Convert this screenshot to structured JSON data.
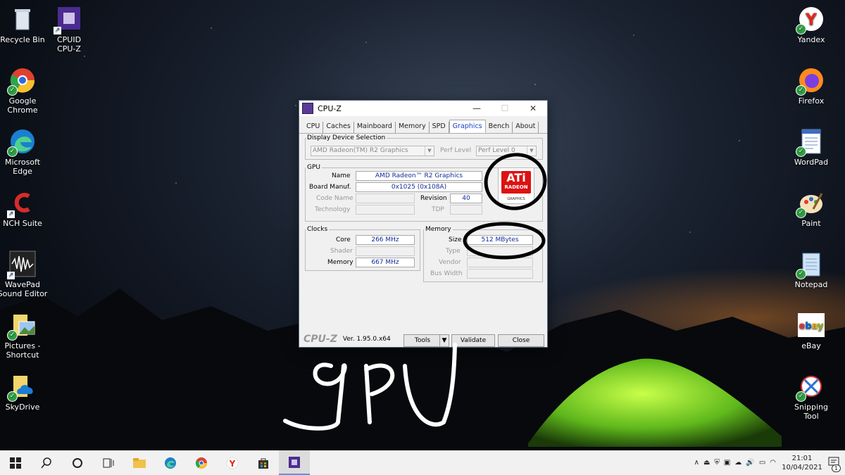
{
  "desktop": {
    "left_icons": [
      {
        "label": "Recycle Bin",
        "icon": "recycle-bin-icon"
      },
      {
        "label": "CPUID\nCPU-Z",
        "icon": "cpuz-icon"
      },
      {
        "label": "Google\nChrome",
        "icon": "chrome-icon"
      },
      {
        "label": "Microsoft\nEdge",
        "icon": "edge-icon"
      },
      {
        "label": "NCH Suite",
        "icon": "nch-icon"
      },
      {
        "label": "WavePad\nSound Editor",
        "icon": "wavepad-icon"
      },
      {
        "label": "Pictures -\nShortcut",
        "icon": "pictures-icon"
      },
      {
        "label": "SkyDrive",
        "icon": "skydrive-icon"
      }
    ],
    "right_icons": [
      {
        "label": "Yandex",
        "icon": "yandex-icon"
      },
      {
        "label": "Firefox",
        "icon": "firefox-icon"
      },
      {
        "label": "WordPad",
        "icon": "wordpad-icon"
      },
      {
        "label": "Paint",
        "icon": "paint-icon"
      },
      {
        "label": "Notepad",
        "icon": "notepad-icon"
      },
      {
        "label": "eBay",
        "icon": "ebay-icon"
      },
      {
        "label": "Snipping\nTool",
        "icon": "snipping-tool-icon"
      }
    ],
    "annotation_text": "gpu"
  },
  "window": {
    "title": "CPU-Z",
    "tabs": [
      "CPU",
      "Caches",
      "Mainboard",
      "Memory",
      "SPD",
      "Graphics",
      "Bench",
      "About"
    ],
    "active_tab": "Graphics",
    "display_device": {
      "legend": "Display Device Selection",
      "selected": "AMD Radeon(TM) R2 Graphics",
      "perf_level_label": "Perf Level",
      "perf_level_value": "Perf Level 0"
    },
    "gpu": {
      "legend": "GPU",
      "name_label": "Name",
      "name_value": "AMD Radeon™ R2 Graphics",
      "board_label": "Board Manuf.",
      "board_value": "0x1025 (0x108A)",
      "codename_label": "Code Name",
      "revision_label": "Revision",
      "revision_value": "40",
      "technology_label": "Technology",
      "tdp_label": "TDP",
      "logo_main": "ATi",
      "logo_sub": "RADEON",
      "logo_graphics": "GRAPHICS"
    },
    "clocks": {
      "legend": "Clocks",
      "core_label": "Core",
      "core_value": "266 MHz",
      "shader_label": "Shader",
      "memory_label": "Memory",
      "memory_value": "667 MHz"
    },
    "memory": {
      "legend": "Memory",
      "size_label": "Size",
      "size_value": "512 MBytes",
      "type_label": "Type",
      "vendor_label": "Vendor",
      "bus_width_label": "Bus Width"
    },
    "footer": {
      "logo": "CPU-Z",
      "version": "Ver. 1.95.0.x64",
      "tools_label": "Tools",
      "validate_label": "Validate",
      "close_label": "Close"
    }
  },
  "taskbar": {
    "time": "21:01",
    "date": "10/04/2021",
    "notification_count": "1"
  }
}
